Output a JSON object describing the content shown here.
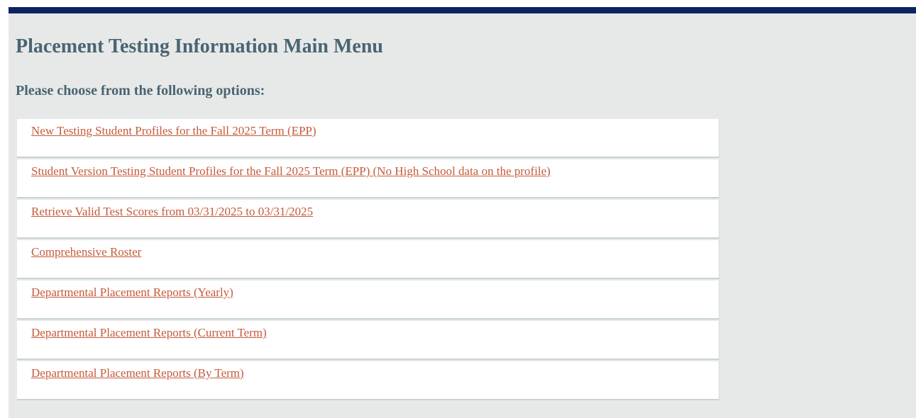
{
  "colors": {
    "top_bar": "#0c2461",
    "background": "#e6e9e8",
    "heading": "#4a6472",
    "link": "#c55a3a",
    "item_background": "#ffffff"
  },
  "header": {
    "title": "Placement Testing Information Main Menu",
    "subtitle": "Please choose from the following options:"
  },
  "menu": {
    "items": [
      {
        "label": "New Testing Student Profiles for the Fall 2025 Term (EPP)"
      },
      {
        "label": "Student Version Testing Student Profiles for the Fall 2025 Term (EPP) (No High School data on the profile)"
      },
      {
        "label": "Retrieve Valid Test Scores from 03/31/2025 to 03/31/2025"
      },
      {
        "label": "Comprehensive Roster"
      },
      {
        "label": "Departmental Placement Reports (Yearly)"
      },
      {
        "label": "Departmental Placement Reports (Current Term)"
      },
      {
        "label": "Departmental Placement Reports (By Term)"
      }
    ]
  }
}
